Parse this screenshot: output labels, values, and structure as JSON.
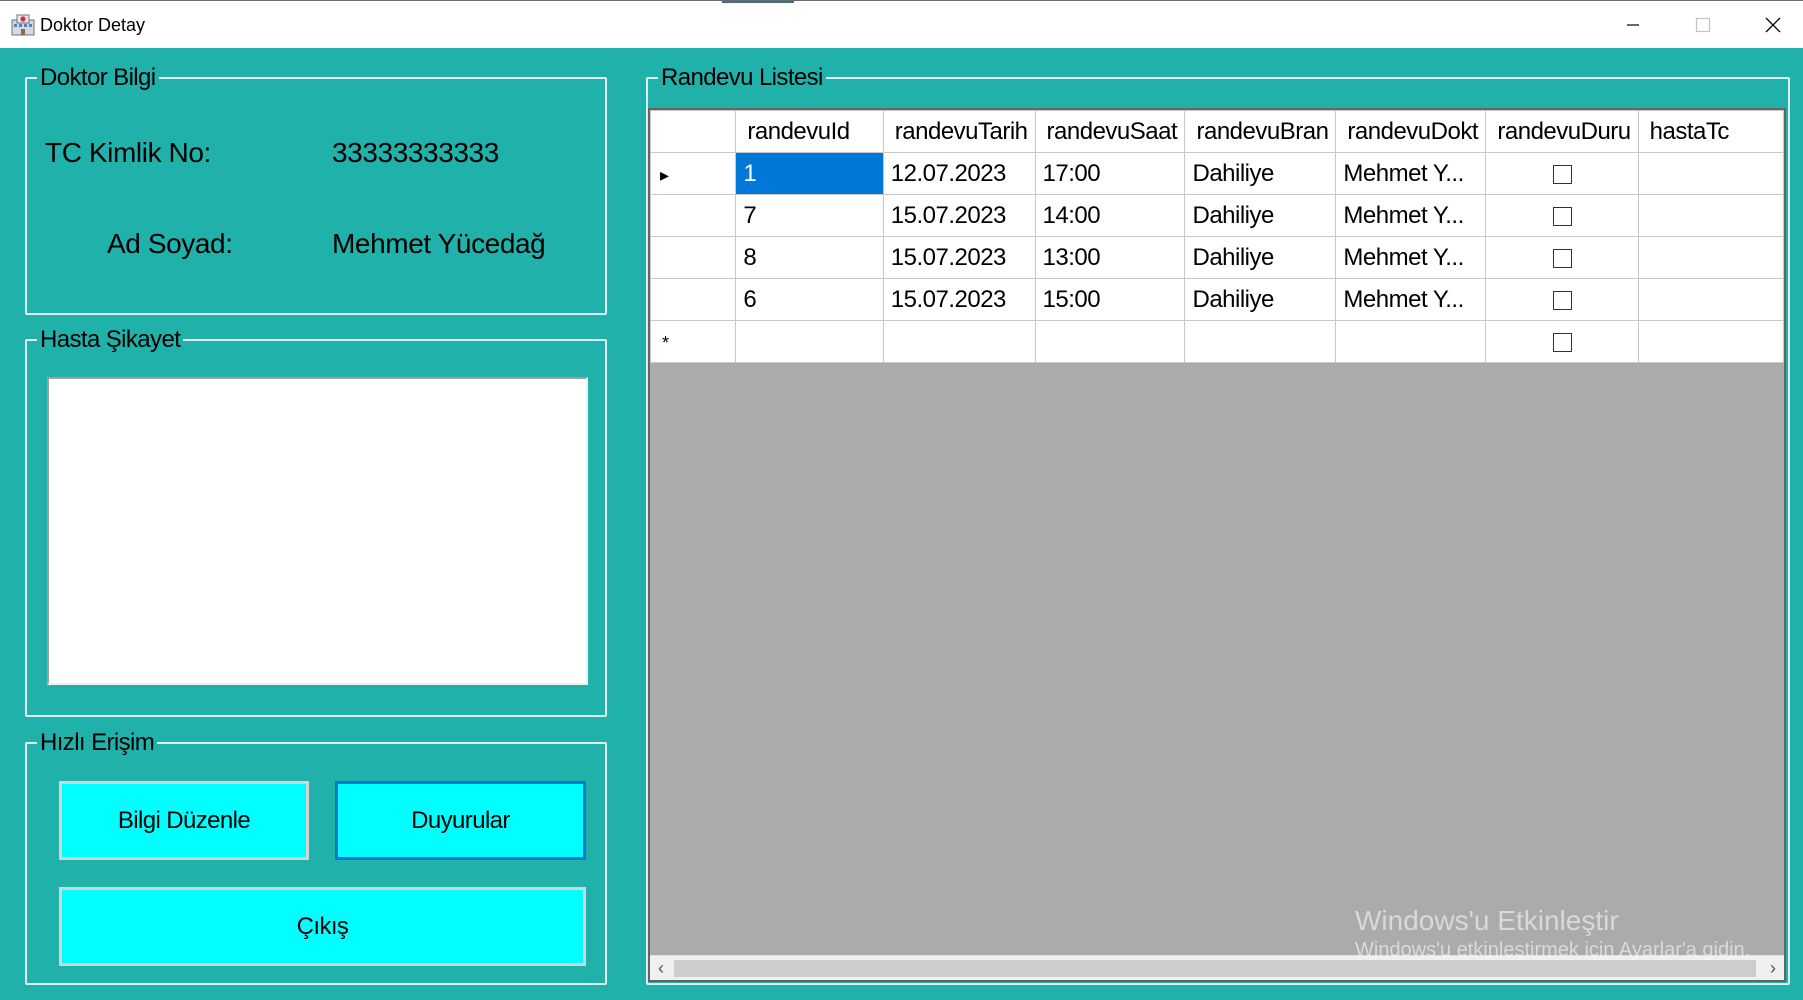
{
  "window": {
    "title": "Doktor Detay"
  },
  "doktor_bilgi": {
    "group_title": "Doktor Bilgi",
    "tc_label": "TC Kimlik No:",
    "tc_value": "33333333333",
    "ad_label": "Ad Soyad:",
    "ad_value": "Mehmet Yücedağ"
  },
  "hasta_sikayet": {
    "group_title": "Hasta Şikayet",
    "value": ""
  },
  "hizli_erisim": {
    "group_title": "Hızlı Erişim",
    "bilgi_duzenle": "Bilgi Düzenle",
    "duyurular": "Duyurular",
    "cikis": "Çıkış"
  },
  "randevu_listesi": {
    "group_title": "Randevu Listesi",
    "columns": [
      "randevuId",
      "randevuTarih",
      "randevuSaat",
      "randevuBran",
      "randevuDokt",
      "randevuDuru",
      "hastaTc"
    ],
    "rows": [
      {
        "id": "1",
        "tarih": "12.07.2023",
        "saat": "17:00",
        "brans": "Dahiliye",
        "doktor": "Mehmet Y...",
        "durum": false,
        "hastaTc": ""
      },
      {
        "id": "7",
        "tarih": "15.07.2023",
        "saat": "14:00",
        "brans": "Dahiliye",
        "doktor": "Mehmet Y...",
        "durum": false,
        "hastaTc": ""
      },
      {
        "id": "8",
        "tarih": "15.07.2023",
        "saat": "13:00",
        "brans": "Dahiliye",
        "doktor": "Mehmet Y...",
        "durum": false,
        "hastaTc": ""
      },
      {
        "id": "6",
        "tarih": "15.07.2023",
        "saat": "15:00",
        "brans": "Dahiliye",
        "doktor": "Mehmet Y...",
        "durum": false,
        "hastaTc": ""
      }
    ],
    "new_row_marker": "*",
    "current_row_marker": "▸"
  },
  "watermark": {
    "line1": "Windows'u Etkinleştir",
    "line2": "Windows'u etkinleştirmek için Ayarlar'a gidin."
  },
  "colors": {
    "background": "#20b2aa",
    "button": "#00ffff",
    "selection": "#0078d7"
  }
}
